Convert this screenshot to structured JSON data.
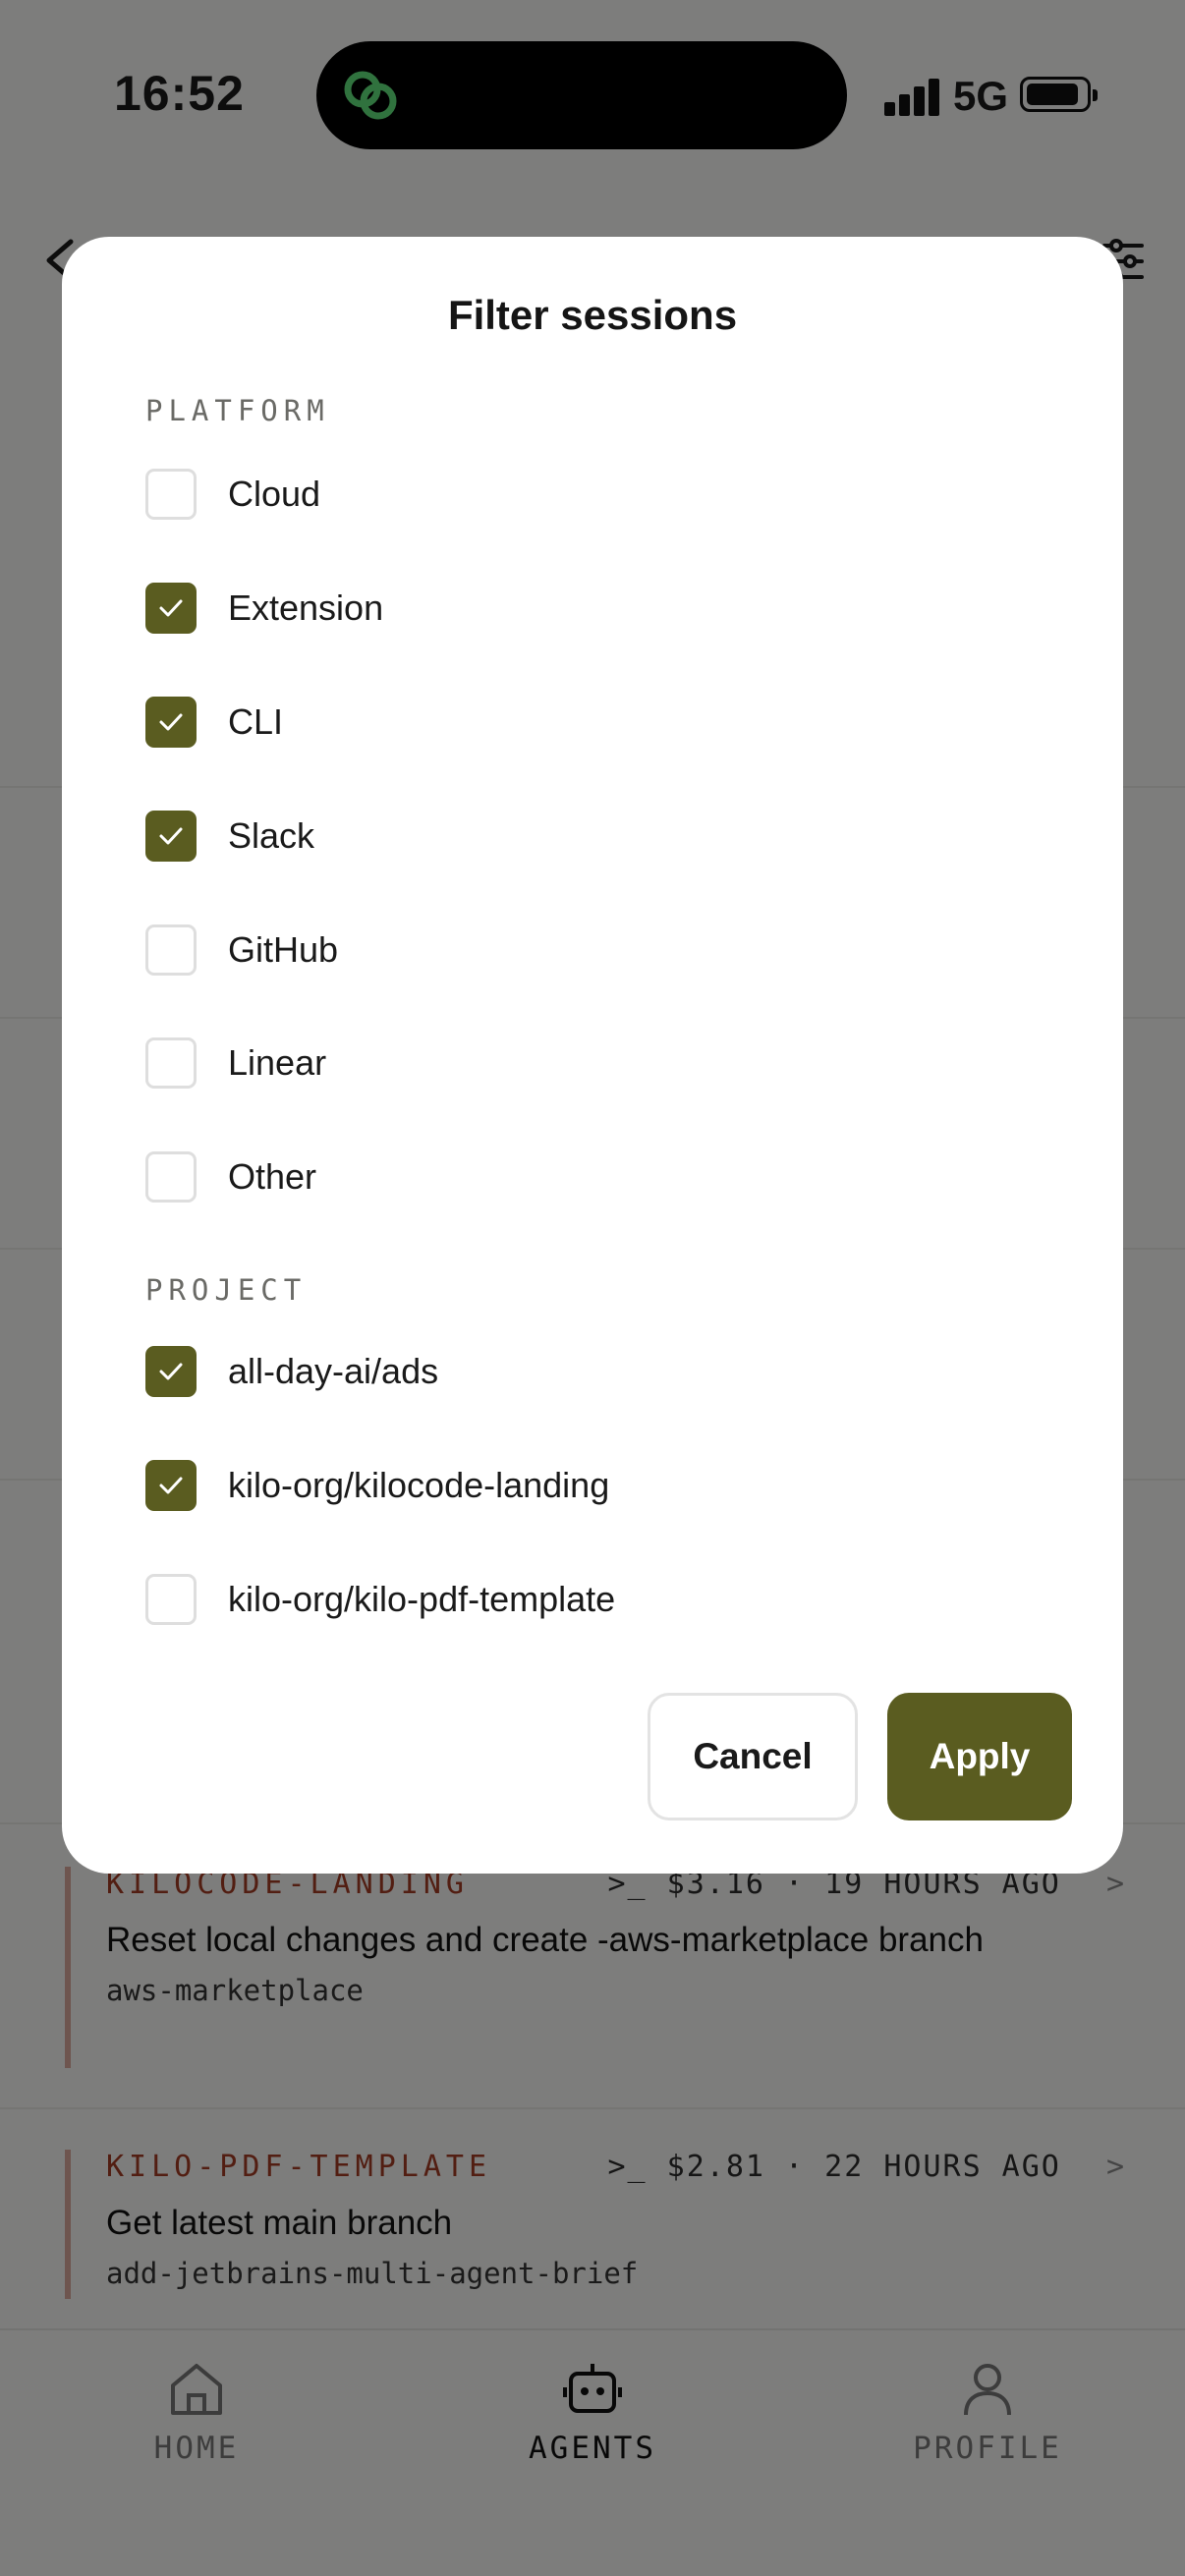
{
  "status_bar": {
    "time": "16:52",
    "network": "5G"
  },
  "sessions": [
    {
      "project": "KILOCODE-LANDING",
      "meta": "$3.16 · 19 HOURS AGO",
      "title": "Reset local changes and create -aws-marketplace branch",
      "branch": "aws-marketplace"
    },
    {
      "project": "KILO-PDF-TEMPLATE",
      "meta": "$2.81 · 22 HOURS AGO",
      "title": "Get latest main branch",
      "branch": "add-jetbrains-multi-agent-brief"
    }
  ],
  "tabs": [
    {
      "label": "HOME",
      "active": false
    },
    {
      "label": "AGENTS",
      "active": true
    },
    {
      "label": "PROFILE",
      "active": false
    }
  ],
  "modal": {
    "title": "Filter sessions",
    "platform_label": "PLATFORM",
    "platforms": [
      {
        "label": "Cloud",
        "checked": false
      },
      {
        "label": "Extension",
        "checked": true
      },
      {
        "label": "CLI",
        "checked": true
      },
      {
        "label": "Slack",
        "checked": true
      },
      {
        "label": "GitHub",
        "checked": false
      },
      {
        "label": "Linear",
        "checked": false
      },
      {
        "label": "Other",
        "checked": false
      }
    ],
    "project_label": "PROJECT",
    "projects": [
      {
        "label": "all-day-ai/ads",
        "checked": true
      },
      {
        "label": "kilo-org/kilocode-landing",
        "checked": true
      },
      {
        "label": "kilo-org/kilo-pdf-template",
        "checked": false
      }
    ],
    "cancel_label": "Cancel",
    "apply_label": "Apply"
  },
  "colors": {
    "accent": "#5a5c20",
    "project_tag": "#a23b24",
    "island_logo": "#5ee07a"
  }
}
